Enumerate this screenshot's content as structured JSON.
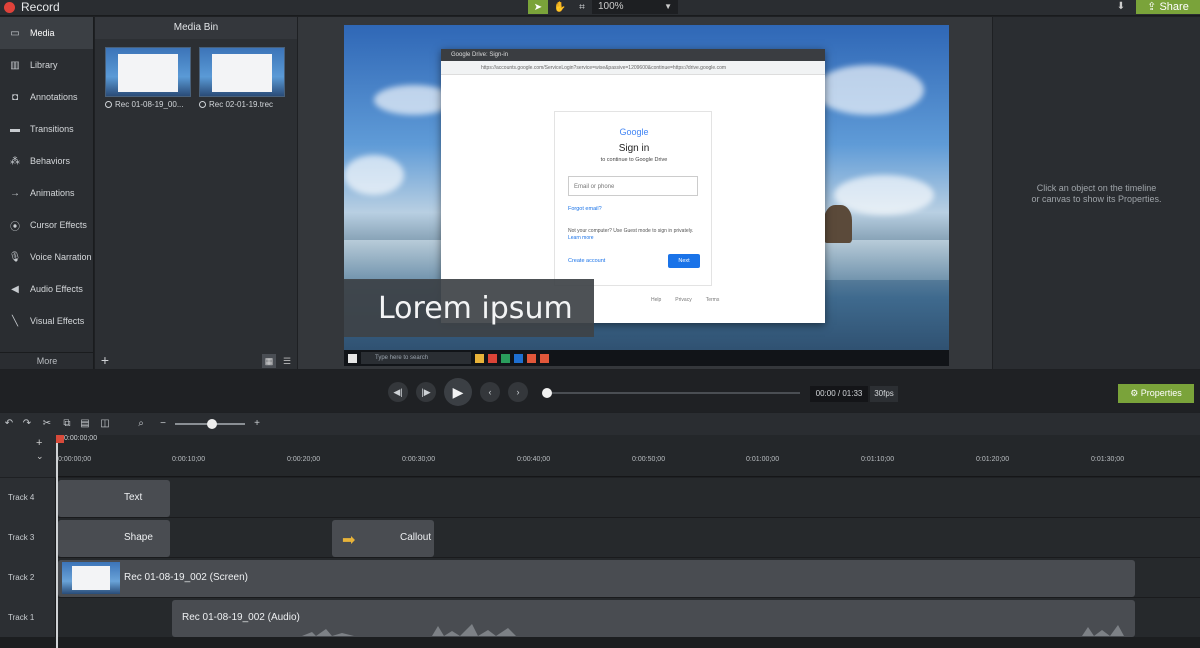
{
  "topbar": {
    "record_label": "Record",
    "zoom_value": "100%",
    "share_label": "Share"
  },
  "nav": {
    "items": [
      {
        "label": "Media",
        "icon": "film-icon"
      },
      {
        "label": "Library",
        "icon": "library-icon"
      },
      {
        "label": "Annotations",
        "icon": "annotation-icon"
      },
      {
        "label": "Transitions",
        "icon": "transition-icon"
      },
      {
        "label": "Behaviors",
        "icon": "behavior-icon"
      },
      {
        "label": "Animations",
        "icon": "animation-icon"
      },
      {
        "label": "Cursor Effects",
        "icon": "cursor-icon"
      },
      {
        "label": "Voice Narration",
        "icon": "microphone-icon"
      },
      {
        "label": "Audio Effects",
        "icon": "speaker-icon"
      },
      {
        "label": "Visual Effects",
        "icon": "wand-icon"
      }
    ],
    "more_label": "More"
  },
  "media_bin": {
    "title": "Media Bin",
    "items": [
      {
        "label": "Rec 01-08-19_00..."
      },
      {
        "label": "Rec 02-01-19.trec"
      }
    ]
  },
  "canvas": {
    "browser_tab": "Google Drive: Sign-in",
    "browser_url": "https://accounts.google.com/ServiceLogin?service=wise&passive=1209600&continue=https://drive.google.com",
    "google_logo": "Google",
    "signin_title": "Sign in",
    "signin_sub": "to continue to Google Drive",
    "email_placeholder": "Email or phone",
    "forgot_email": "Forgot email?",
    "guest_text": "Not your computer? Use Guest mode to sign in privately.",
    "learn_more": "Learn more",
    "create_account": "Create account",
    "next_label": "Next",
    "footer": [
      "Help",
      "Privacy",
      "Terms"
    ],
    "taskbar_search": "Type here to search",
    "lower_third_text": "Lorem ipsum"
  },
  "properties_panel": {
    "hint_line1": "Click an object on the timeline",
    "hint_line2": "or canvas to show its Properties."
  },
  "playback": {
    "timecode": "00:00 / 01:33",
    "fps": "30fps",
    "properties_label": "Properties"
  },
  "timeline": {
    "playhead_time": "0:00:00;00",
    "ruler_labels": [
      "0:00:00;00",
      "0:00:10;00",
      "0:00:20;00",
      "0:00:30;00",
      "0:00:40;00",
      "0:00:50;00",
      "0:01:00;00",
      "0:01:10;00",
      "0:01:20;00",
      "0:01:30;00"
    ],
    "tracks": [
      {
        "label": "Track 4",
        "clips": [
          {
            "label": "Text"
          }
        ]
      },
      {
        "label": "Track 3",
        "clips": [
          {
            "label": "Shape"
          },
          {
            "label": "Callout"
          }
        ]
      },
      {
        "label": "Track 2",
        "clips": [
          {
            "label": "Rec 01-08-19_002 (Screen)"
          }
        ]
      },
      {
        "label": "Track 1",
        "clips": [
          {
            "label": "Rec 01-08-19_002 (Audio)"
          }
        ]
      }
    ]
  },
  "colors": {
    "accent_green": "#7aa33a",
    "record_red": "#e0423a",
    "callout_yellow": "#e8b339"
  }
}
